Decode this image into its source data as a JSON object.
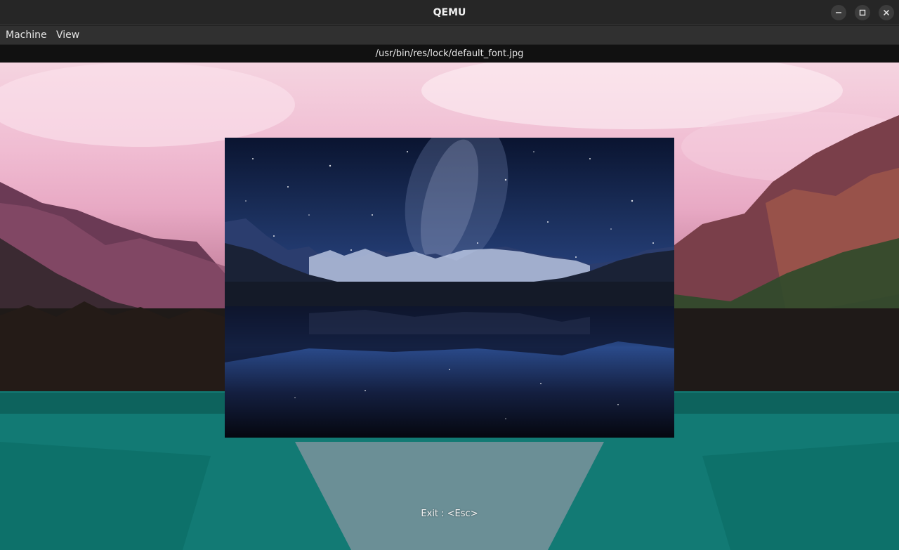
{
  "window": {
    "title": "QEMU",
    "controls": {
      "minimize": "minimize-icon",
      "maximize": "maximize-icon",
      "close": "close-icon"
    }
  },
  "menu": {
    "items": [
      {
        "label": "Machine"
      },
      {
        "label": "View"
      }
    ]
  },
  "path_bar": {
    "text": "/usr/bin/res/lock/default_font.jpg"
  },
  "screen": {
    "hint": "Exit : <Esc>"
  },
  "colors": {
    "titlebar": "#262626",
    "menubar": "#303030",
    "pathbar": "#111111",
    "text": "#e6e6e6"
  }
}
